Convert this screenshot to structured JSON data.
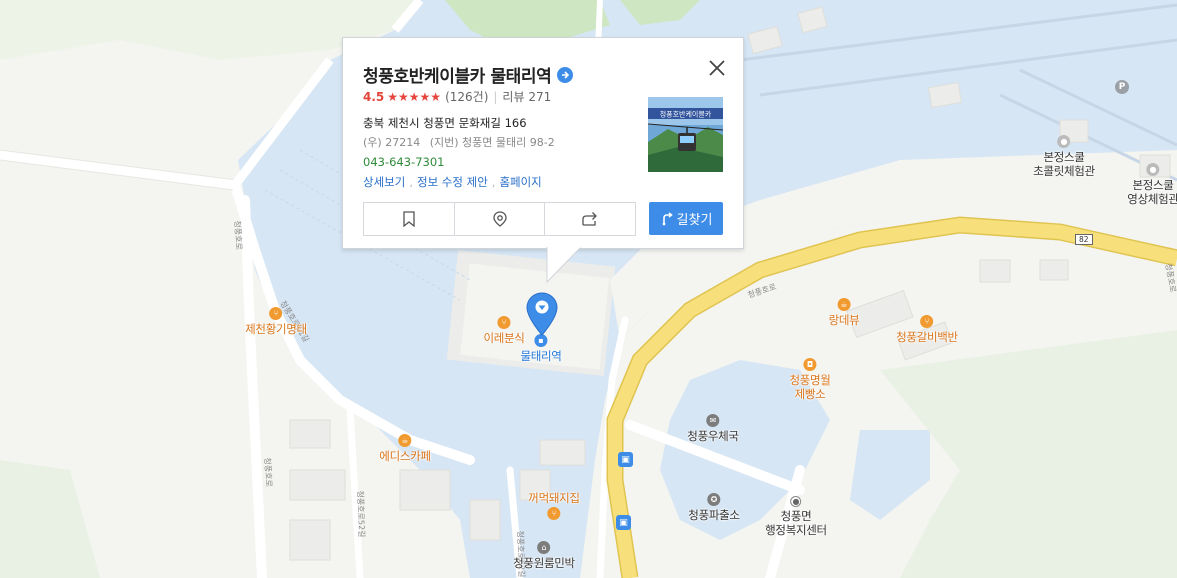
{
  "popup": {
    "title": "청풍호반케이블카 물태리역",
    "rating_score": "4.5",
    "rating_stars": "★★★★★",
    "rating_count": "(126건)",
    "review_count": "리뷰 271",
    "address_road": "충북 제천시 청풍면 문화재길 166",
    "postal_code": "(우) 27214",
    "address_jibun": "(지번) 청풍면 물태리 98-2",
    "phone": "043-643-7301",
    "links": [
      "상세보기",
      "정보 수정 제안",
      "홈페이지"
    ],
    "thumbnail_text": "청풍호반케이블카",
    "route_button": "길찾기",
    "action_icons": [
      "bookmark-icon",
      "location-pin-icon",
      "share-icon"
    ]
  },
  "map": {
    "selected_marker_label": "물태리역",
    "pois": [
      {
        "name": "이레분식",
        "type": "restaurant",
        "color": "orange"
      },
      {
        "name": "물태리역",
        "type": "cable-car-station",
        "color": "blue"
      },
      {
        "name": "제천황기명태",
        "type": "restaurant",
        "color": "orange"
      },
      {
        "name": "에디스카페",
        "type": "cafe",
        "color": "orange"
      },
      {
        "name": "꺼먹돼지집",
        "type": "restaurant",
        "color": "orange"
      },
      {
        "name": "청풍원룸민박",
        "type": "lodging",
        "color": "gray"
      },
      {
        "name": "랑데뷰",
        "type": "cafe",
        "color": "orange"
      },
      {
        "name": "청풍갈비백반",
        "type": "restaurant",
        "color": "orange"
      },
      {
        "name": "청풍명월\n제빵소",
        "type": "bakery",
        "color": "orange"
      },
      {
        "name": "청풍우체국",
        "type": "post-office",
        "color": "gray"
      },
      {
        "name": "청풍파출소",
        "type": "police",
        "color": "gray"
      },
      {
        "name": "청풍면\n행정복지센터",
        "type": "government",
        "color": "gray"
      },
      {
        "name": "본정스쿨\n초콜릿체험관",
        "type": "attraction",
        "color": "gray"
      },
      {
        "name": "본정스쿨\n영상체험관",
        "type": "attraction",
        "color": "gray"
      }
    ],
    "road_labels": [
      "청풍호로",
      "청풍호로",
      "청풍호로51길",
      "청풍호로52길",
      "청풍호로52길",
      "청풍호로",
      "청풍호로"
    ],
    "route_shield": "82",
    "parking_badge": "P",
    "colors": {
      "water": "#d6e6f4",
      "land": "#f4f4f1",
      "major_road": "#f7e07c",
      "major_road_border": "#e0c451",
      "green": "#cfe6c2",
      "accent_blue": "#3d8ce8"
    }
  }
}
